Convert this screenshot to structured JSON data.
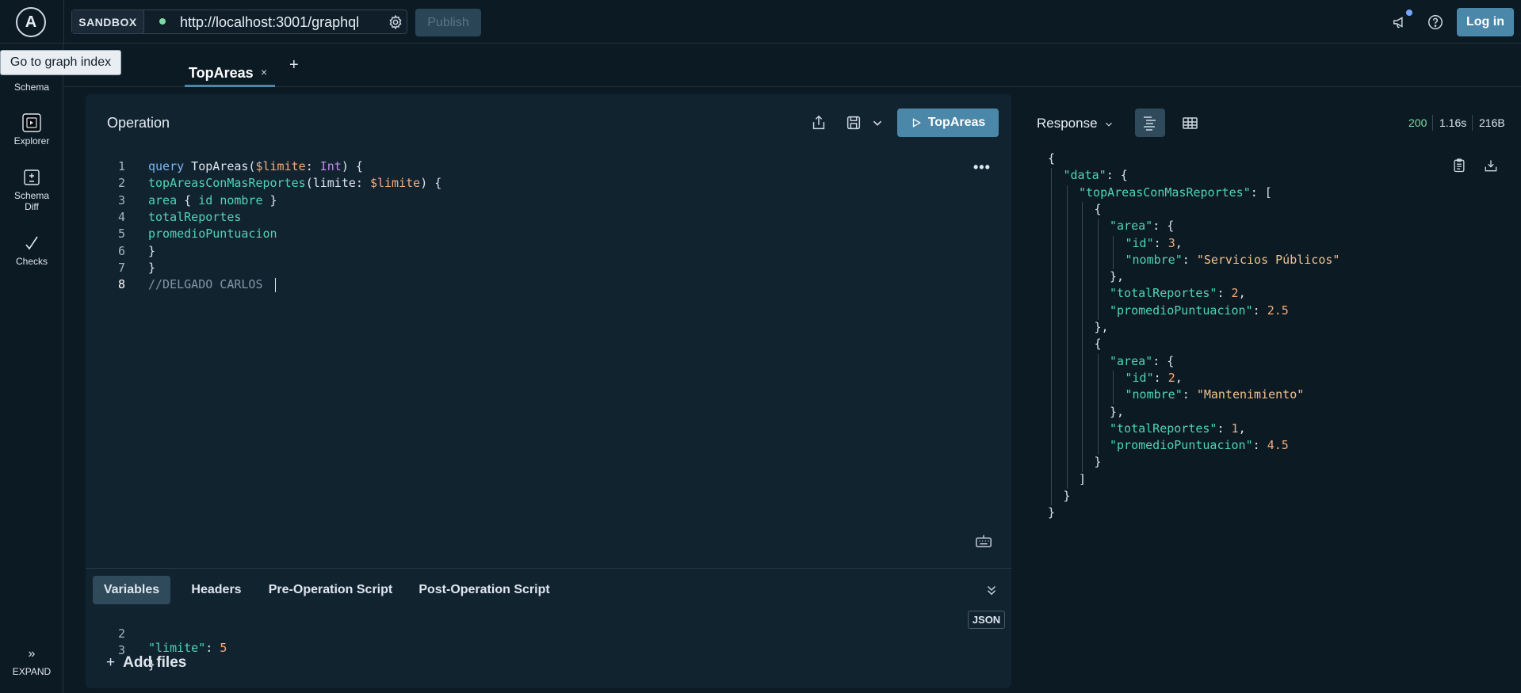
{
  "topbar": {
    "logo_letter": "A",
    "sandbox_label": "SANDBOX",
    "endpoint": "http://localhost:3001/graphql",
    "publish_label": "Publish",
    "login_label": "Log in"
  },
  "tooltip": "Go to graph index",
  "sidebar": {
    "items": [
      {
        "label": "Schema",
        "icon": "schema-icon"
      },
      {
        "label": "Explorer",
        "icon": "explorer-icon"
      },
      {
        "label": "Schema",
        "label2": "Diff",
        "icon": "schema-diff-icon"
      },
      {
        "label": "Checks",
        "icon": "checks-icon"
      }
    ],
    "expand_label": "EXPAND"
  },
  "tabs": {
    "active_label": "TopAreas",
    "close_glyph": "×",
    "add_glyph": "+"
  },
  "operation": {
    "title": "Operation",
    "run_label": "TopAreas",
    "more_glyph": "•••",
    "lines": [
      {
        "n": "1",
        "tokens": [
          [
            "kw",
            "query"
          ],
          [
            "plain",
            " TopAreas("
          ],
          [
            "var",
            "$limite"
          ],
          [
            "plain",
            ": "
          ],
          [
            "ty",
            "Int"
          ],
          [
            "plain",
            ") {"
          ]
        ]
      },
      {
        "n": "2",
        "tokens": [
          [
            "fld",
            "topAreasConMasReportes"
          ],
          [
            "plain",
            "(limite: "
          ],
          [
            "var",
            "$limite"
          ],
          [
            "plain",
            ") {"
          ]
        ]
      },
      {
        "n": "3",
        "tokens": [
          [
            "fld",
            "area"
          ],
          [
            "plain",
            " { "
          ],
          [
            "fld",
            "id"
          ],
          [
            "plain",
            " "
          ],
          [
            "fld",
            "nombre"
          ],
          [
            "plain",
            " }"
          ]
        ]
      },
      {
        "n": "4",
        "tokens": [
          [
            "fld",
            "totalReportes"
          ]
        ]
      },
      {
        "n": "5",
        "tokens": [
          [
            "fld",
            "promedioPuntuacion"
          ]
        ]
      },
      {
        "n": "6",
        "tokens": [
          [
            "plain",
            "}"
          ]
        ]
      },
      {
        "n": "7",
        "tokens": [
          [
            "plain",
            "}"
          ]
        ]
      },
      {
        "n": "8",
        "tokens": [
          [
            "com",
            "//DELGADO CARLOS "
          ]
        ]
      }
    ]
  },
  "lower": {
    "tabs": [
      "Variables",
      "Headers",
      "Pre-Operation Script",
      "Post-Operation Script"
    ],
    "json_badge": "JSON",
    "var_lines": [
      {
        "n": "2",
        "key": "\"limite\"",
        "value": "5"
      },
      {
        "n": "3",
        "text": "}"
      }
    ],
    "add_files_label": "Add files"
  },
  "response": {
    "label": "Response",
    "status": "200",
    "time": "1.16s",
    "size": "216B",
    "lines": [
      {
        "indent": 0,
        "tokens": [
          [
            "p",
            "{"
          ]
        ]
      },
      {
        "indent": 1,
        "tokens": [
          [
            "k",
            "\"data\""
          ],
          [
            "p",
            ": {"
          ]
        ]
      },
      {
        "indent": 2,
        "tokens": [
          [
            "k",
            "\"topAreasConMasReportes\""
          ],
          [
            "p",
            ": ["
          ]
        ]
      },
      {
        "indent": 3,
        "tokens": [
          [
            "p",
            "{"
          ]
        ]
      },
      {
        "indent": 4,
        "tokens": [
          [
            "k",
            "\"area\""
          ],
          [
            "p",
            ": {"
          ]
        ]
      },
      {
        "indent": 5,
        "tokens": [
          [
            "k",
            "\"id\""
          ],
          [
            "p",
            ": "
          ],
          [
            "n",
            "3"
          ],
          [
            "p",
            ","
          ]
        ]
      },
      {
        "indent": 5,
        "tokens": [
          [
            "k",
            "\"nombre\""
          ],
          [
            "p",
            ": "
          ],
          [
            "s",
            "\"Servicios Públicos\""
          ]
        ]
      },
      {
        "indent": 4,
        "tokens": [
          [
            "p",
            "},"
          ]
        ]
      },
      {
        "indent": 4,
        "tokens": [
          [
            "k",
            "\"totalReportes\""
          ],
          [
            "p",
            ": "
          ],
          [
            "n",
            "2"
          ],
          [
            "p",
            ","
          ]
        ]
      },
      {
        "indent": 4,
        "tokens": [
          [
            "k",
            "\"promedioPuntuacion\""
          ],
          [
            "p",
            ": "
          ],
          [
            "n",
            "2.5"
          ]
        ]
      },
      {
        "indent": 3,
        "tokens": [
          [
            "p",
            "},"
          ]
        ]
      },
      {
        "indent": 3,
        "tokens": [
          [
            "p",
            "{"
          ]
        ]
      },
      {
        "indent": 4,
        "tokens": [
          [
            "k",
            "\"area\""
          ],
          [
            "p",
            ": {"
          ]
        ]
      },
      {
        "indent": 5,
        "tokens": [
          [
            "k",
            "\"id\""
          ],
          [
            "p",
            ": "
          ],
          [
            "n",
            "2"
          ],
          [
            "p",
            ","
          ]
        ]
      },
      {
        "indent": 5,
        "tokens": [
          [
            "k",
            "\"nombre\""
          ],
          [
            "p",
            ": "
          ],
          [
            "s",
            "\"Mantenimiento\""
          ]
        ]
      },
      {
        "indent": 4,
        "tokens": [
          [
            "p",
            "},"
          ]
        ]
      },
      {
        "indent": 4,
        "tokens": [
          [
            "k",
            "\"totalReportes\""
          ],
          [
            "p",
            ": "
          ],
          [
            "n",
            "1"
          ],
          [
            "p",
            ","
          ]
        ]
      },
      {
        "indent": 4,
        "tokens": [
          [
            "k",
            "\"promedioPuntuacion\""
          ],
          [
            "p",
            ": "
          ],
          [
            "n",
            "4.5"
          ]
        ]
      },
      {
        "indent": 3,
        "tokens": [
          [
            "p",
            "}"
          ]
        ]
      },
      {
        "indent": 2,
        "tokens": [
          [
            "p",
            "]"
          ]
        ]
      },
      {
        "indent": 1,
        "tokens": [
          [
            "p",
            "}"
          ]
        ]
      },
      {
        "indent": 0,
        "tokens": [
          [
            "p",
            "}"
          ]
        ]
      }
    ]
  },
  "colors": {
    "background": "#0c1a24",
    "panel": "#122330",
    "accent": "#4a87a8",
    "field": "#4fd5b4",
    "number": "#f2ad7c",
    "string": "#f2c28c"
  }
}
